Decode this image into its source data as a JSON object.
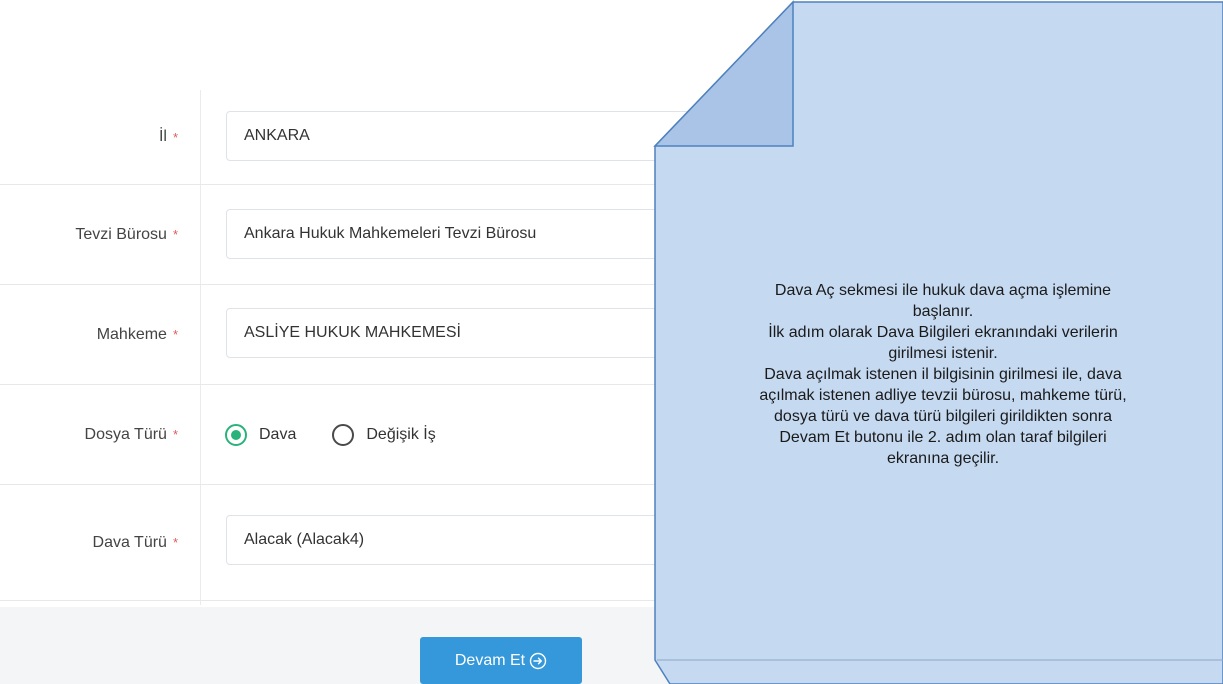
{
  "form": {
    "fields": [
      {
        "label": "İl",
        "required": "*",
        "value": "ANKARA"
      },
      {
        "label": "Tevzi Bürosu",
        "required": "*",
        "value": "Ankara Hukuk Mahkemeleri Tevzi Bürosu"
      },
      {
        "label": "Mahkeme",
        "required": "*",
        "value": "ASLİYE HUKUK MAHKEMESİ"
      },
      {
        "label": "Dosya Türü",
        "required": "*",
        "options": [
          "Dava",
          "Değişik İş"
        ],
        "selected": "Dava"
      },
      {
        "label": "Dava Türü",
        "required": "*",
        "value": "Alacak (Alacak4)"
      }
    ],
    "submit_label": "Devam Et"
  },
  "colors": {
    "primary_button": "#3498db",
    "radio_selected": "#2ab27b",
    "required_star": "#e05a5a",
    "note_fill": "#c5d9f1",
    "note_border": "#4f81bd"
  },
  "note": {
    "text": "Dava Aç sekmesi ile hukuk dava açma işlemine\nbaşlanır.\nİlk adım olarak Dava Bilgileri ekranındaki verilerin\ngirilmesi istenir.\nDava açılmak istenen il bilgisinin girilmesi ile, dava\naçılmak istenen adliye tevzii bürosu, mahkeme türü,\ndosya türü ve dava türü bilgileri girildikten sonra\nDevam Et butonu ile 2. adım olan taraf bilgileri\nekranına geçilir."
  }
}
